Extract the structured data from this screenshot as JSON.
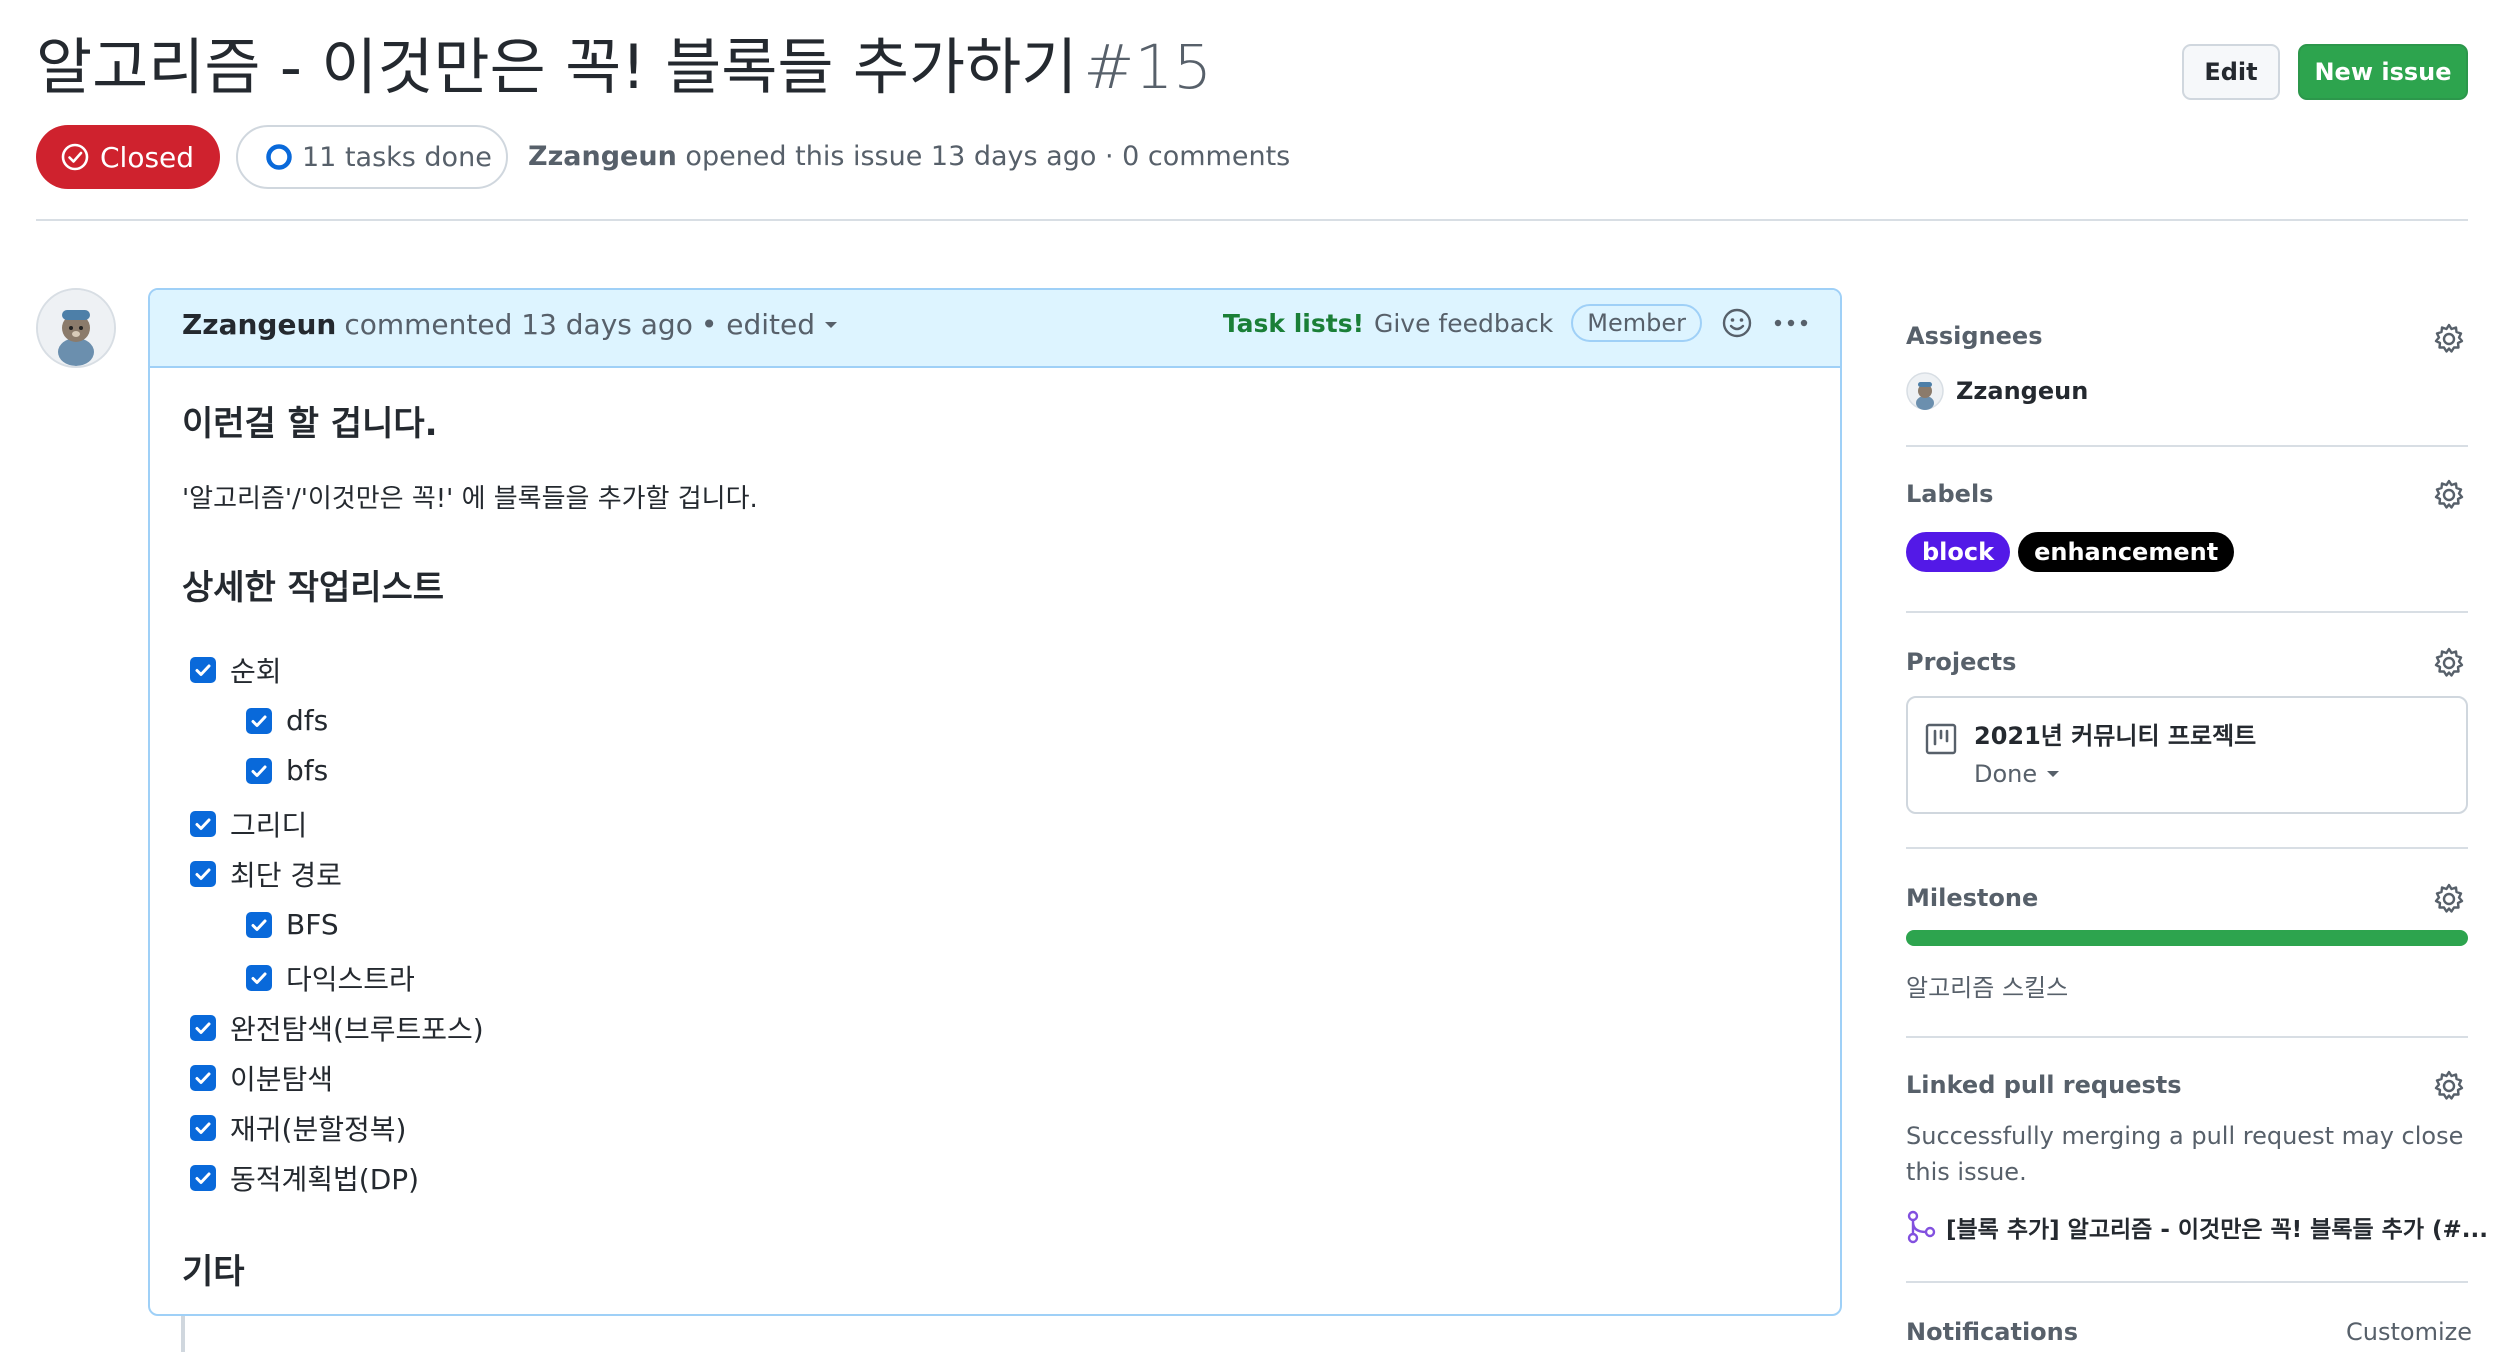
{
  "issue": {
    "title": "알고리즘 - 이것만은 꼭! 블록들 추가하기",
    "number": "#15",
    "status": "Closed",
    "tasks_done": "11 tasks done",
    "author": "Zzangeun",
    "opened_text": "opened this issue 13 days ago · 0 comments"
  },
  "header_buttons": {
    "edit": "Edit",
    "new_issue": "New issue"
  },
  "comment": {
    "author": "Zzangeun",
    "when": "commented 13 days ago",
    "edited": "• edited",
    "task_lists": "Task lists!",
    "feedback": "Give feedback",
    "role": "Member",
    "heading1": "이런걸 할 겁니다.",
    "paragraph": "'알고리즘'/'이것만은 꼭!' 에 블록들을 추가할 겁니다.",
    "heading2": "상세한 작업리스트",
    "tasks": [
      {
        "label": "순회",
        "checked": true,
        "level": 0
      },
      {
        "label": "dfs",
        "checked": true,
        "level": 1
      },
      {
        "label": "bfs",
        "checked": true,
        "level": 1
      },
      {
        "label": "그리디",
        "checked": true,
        "level": 0
      },
      {
        "label": "최단 경로",
        "checked": true,
        "level": 0
      },
      {
        "label": "BFS",
        "checked": true,
        "level": 1
      },
      {
        "label": "다익스트라",
        "checked": true,
        "level": 1
      },
      {
        "label": "완전탐색(브루트포스)",
        "checked": true,
        "level": 0
      },
      {
        "label": "이분탐색",
        "checked": true,
        "level": 0
      },
      {
        "label": "재귀(분할정복)",
        "checked": true,
        "level": 0
      },
      {
        "label": "동적계획법(DP)",
        "checked": true,
        "level": 0
      }
    ],
    "heading3": "기타"
  },
  "sidebar": {
    "assignees": {
      "title": "Assignees",
      "user": "Zzangeun"
    },
    "labels": {
      "title": "Labels",
      "items": [
        {
          "name": "block",
          "color": "#5319e7"
        },
        {
          "name": "enhancement",
          "color": "#000000"
        }
      ]
    },
    "projects": {
      "title": "Projects",
      "name": "2021년 커뮤니티 프로젝트",
      "status": "Done"
    },
    "milestone": {
      "title": "Milestone",
      "name": "알고리즘 스킬스",
      "progress": 1.0
    },
    "linked_prs": {
      "title": "Linked pull requests",
      "description": "Successfully merging a pull request may close this issue.",
      "pr": "[블록 추가] 알고리즘 - 이것만은 꼭! 블록들 추가 (#..."
    },
    "notifications": {
      "title": "Notifications",
      "action": "Customize"
    }
  },
  "colors": {
    "closed": "#cf222e",
    "new_issue": "#2da44e",
    "link_blue": "#0969da",
    "comment_header": "#ddf4ff",
    "milestone_bar": "#2da44e"
  }
}
